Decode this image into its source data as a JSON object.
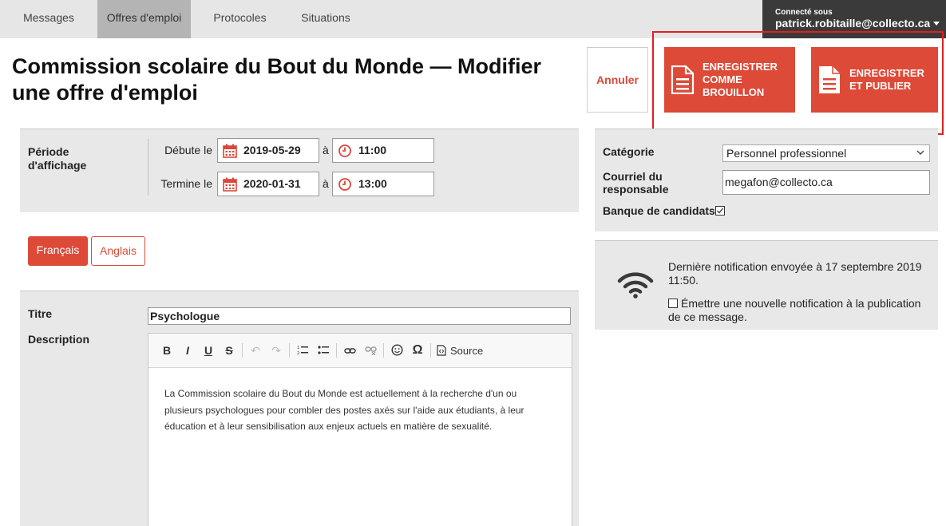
{
  "nav": {
    "tabs": [
      {
        "label": "Messages"
      },
      {
        "label": "Offres d'emploi"
      },
      {
        "label": "Protocoles"
      },
      {
        "label": "Situations"
      }
    ],
    "user": {
      "caption": "Connecté sous",
      "name": "patrick.robitaille@collecto.ca"
    }
  },
  "page": {
    "title": "Commission scolaire du Bout du Monde — Modifier une offre d'emploi"
  },
  "actions": {
    "cancel_label": "Annuler",
    "draft_label": "ENREGISTRER COMME BROUILLON",
    "publish_label": "ENREGISTRER ET PUBLIER"
  },
  "period": {
    "label": "Période d'affichage",
    "start_label": "Débute le",
    "end_label": "Termine le",
    "at_label": "à",
    "start_date": "2019-05-29",
    "start_time": "11:00",
    "end_date": "2020-01-31",
    "end_time": "13:00"
  },
  "languages": {
    "french": "Français",
    "english": "Anglais"
  },
  "form": {
    "title_label": "Titre",
    "title_value": "Psychologue",
    "description_label": "Description",
    "source_label": "Source",
    "description_text": "La Commission scolaire du Bout du Monde est actuellement à la recherche d'un ou plusieurs psychologues pour combler des postes axés sur l'aide aux étudiants, à leur éducation et à leur sensibilisation aux enjeux actuels en matière de sexualité."
  },
  "side": {
    "category_label": "Catégorie",
    "category_value": "Personnel professionnel",
    "email_label": "Courriel du responsable",
    "email_value": "megafon@collecto.ca",
    "bank_label": "Banque de candidats",
    "bank_checked": true
  },
  "notification": {
    "last_sent": "Dernière notification envoyée à 17 septembre 2019 11:50.",
    "emit_label": "Émettre une nouvelle notification à la publication de ce message.",
    "emit_checked": false
  },
  "colors": {
    "accent": "#dd4a38",
    "nav_bg": "#e6e6e6",
    "user_bg": "#3a3a3a",
    "highlight": "#e02020"
  }
}
